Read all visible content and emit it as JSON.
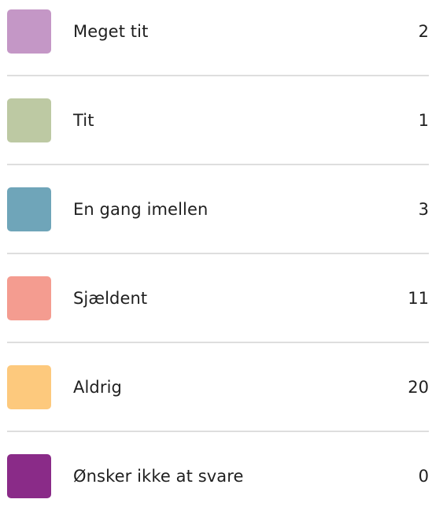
{
  "chart_data": {
    "type": "table",
    "rows": [
      {
        "label": "Meget tit",
        "value": 2,
        "color": "#c497c6"
      },
      {
        "label": "Tit",
        "value": 1,
        "color": "#bdc9a3"
      },
      {
        "label": "En gang imellen",
        "value": 3,
        "color": "#6fa5b9"
      },
      {
        "label": "Sjældent",
        "value": 11,
        "color": "#f49c90"
      },
      {
        "label": "Aldrig",
        "value": 20,
        "color": "#fdc97d"
      },
      {
        "label": "Ønsker ikke at svare",
        "value": 0,
        "color": "#8a2b88"
      }
    ]
  }
}
